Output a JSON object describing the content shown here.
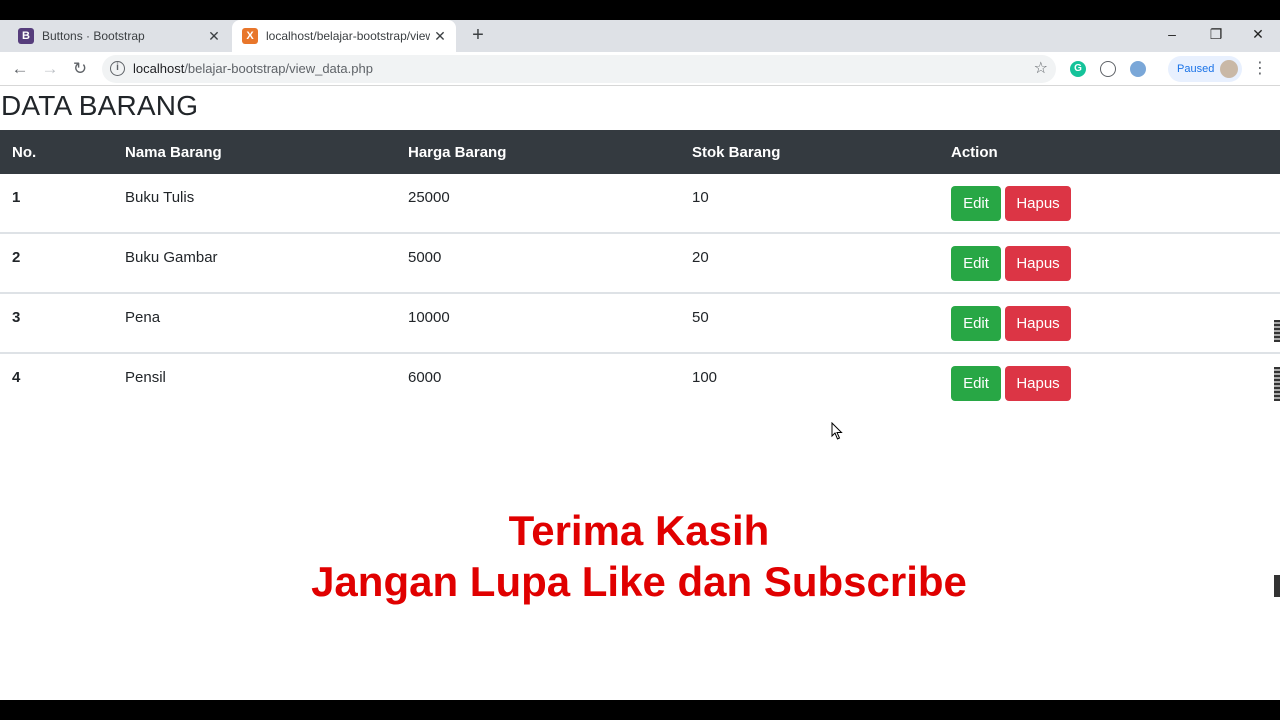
{
  "browser": {
    "tabs": [
      {
        "label": "Buttons · Bootstrap",
        "favicon": "B",
        "active": false
      },
      {
        "label": "localhost/belajar-bootstrap/view_",
        "favicon": "X",
        "active": true
      }
    ],
    "new_tab": "+",
    "window_controls": {
      "minimize": "–",
      "restore": "❐",
      "close": "✕"
    },
    "url_host": "localhost",
    "url_path": "/belajar-bootstrap/view_data.php",
    "profile_label": "Paused"
  },
  "page": {
    "title": "DATA BARANG",
    "table": {
      "headers": [
        "No.",
        "Nama Barang",
        "Harga Barang",
        "Stok Barang",
        "Action"
      ],
      "rows": [
        {
          "no": "1",
          "nama": "Buku Tulis",
          "harga": "25000",
          "stok": "10"
        },
        {
          "no": "2",
          "nama": "Buku Gambar",
          "harga": "5000",
          "stok": "20"
        },
        {
          "no": "3",
          "nama": "Pena",
          "harga": "10000",
          "stok": "50"
        },
        {
          "no": "4",
          "nama": "Pensil",
          "harga": "6000",
          "stok": "100"
        }
      ],
      "edit_label": "Edit",
      "hapus_label": "Hapus"
    },
    "overlay_line1": "Terima Kasih",
    "overlay_line2": "Jangan Lupa Like dan Subscribe"
  },
  "colors": {
    "header_bg": "#343a40",
    "edit_green": "#28a745",
    "hapus_red": "#dc3545",
    "overlay_red": "#e00000"
  }
}
